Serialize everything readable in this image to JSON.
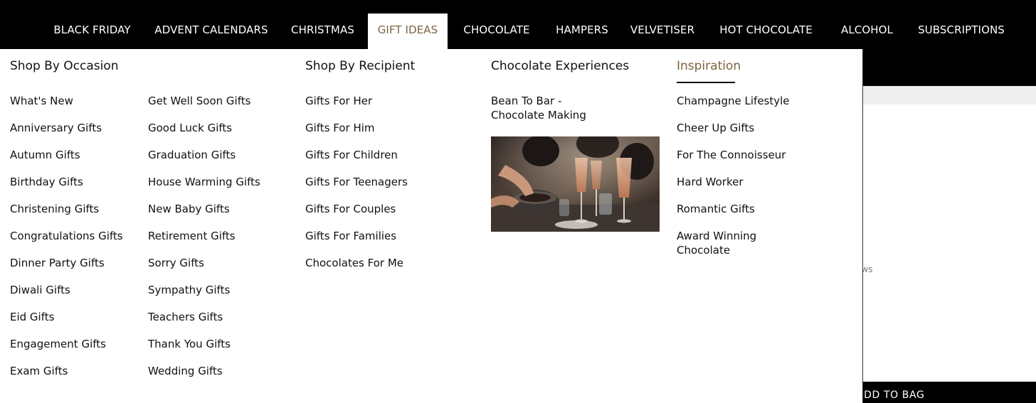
{
  "nav": {
    "items": [
      "BLACK FRIDAY",
      "ADVENT CALENDARS",
      "CHRISTMAS",
      "GIFT IDEAS",
      "CHOCOLATE",
      "HAMPERS",
      "VELVETISER",
      "HOT CHOCOLATE",
      "ALCOHOL",
      "SUBSCRIPTIONS"
    ],
    "active": "GIFT IDEAS"
  },
  "menu": {
    "occasion": {
      "heading": "Shop By Occasion",
      "col1": [
        "What's New",
        "Anniversary Gifts",
        "Autumn Gifts",
        "Birthday Gifts",
        "Christening Gifts",
        "Congratulations Gifts",
        "Dinner Party Gifts",
        "Diwali Gifts",
        "Eid Gifts",
        "Engagement Gifts",
        "Exam Gifts"
      ],
      "col2": [
        "Get Well Soon Gifts",
        "Good Luck Gifts",
        "Graduation Gifts",
        "House Warming Gifts",
        "New Baby Gifts",
        "Retirement Gifts",
        "Sorry Gifts",
        "Sympathy Gifts",
        "Teachers Gifts",
        "Thank You Gifts",
        "Wedding Gifts"
      ]
    },
    "recipient": {
      "heading": "Shop By Recipient",
      "items": [
        "Gifts For Her",
        "Gifts For Him",
        "Gifts For Children",
        "Gifts For Teenagers",
        "Gifts For Couples",
        "Gifts For Families",
        "Chocolates For Me"
      ]
    },
    "experiences": {
      "heading": "Chocolate Experiences",
      "link_line1": "Bean To Bar -",
      "link_line2": "Chocolate Making"
    },
    "inspiration": {
      "heading": "Inspiration",
      "items": [
        "Champagne Lifestyle",
        "Cheer Up Gifts",
        "For The Connoisseur",
        "Hard Worker",
        "Romantic Gifts"
      ],
      "last_line1": "Award Winning",
      "last_line2": "Chocolate"
    }
  },
  "background_page": {
    "reviews_fragment": "ews",
    "add_to_bag": "ADD TO BAG"
  },
  "colors": {
    "nav_bg": "#000000",
    "accent": "#7a6441",
    "text": "#111111"
  }
}
